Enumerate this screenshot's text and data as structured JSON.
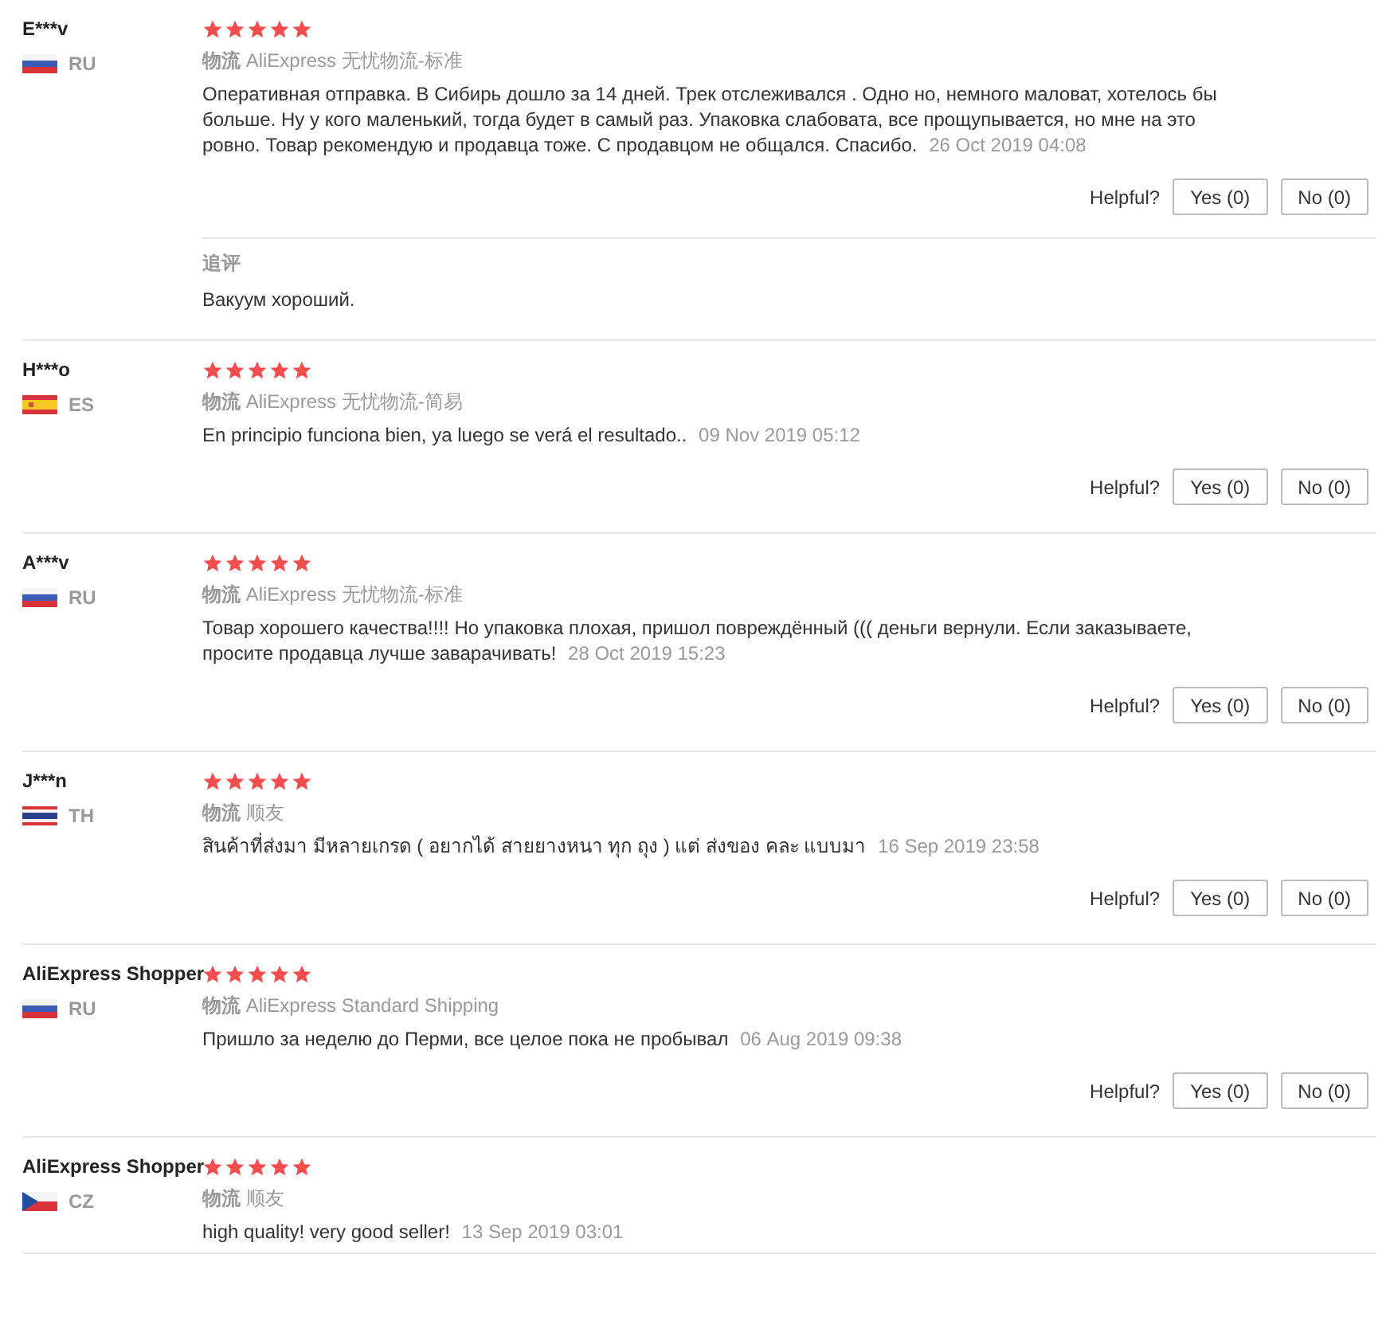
{
  "reviews": [
    {
      "name": "E***v",
      "flag": {
        "kind": "ru"
      },
      "country": "RU",
      "stars": 5,
      "shipping_label": "物流",
      "shipping": "AliExpress 无忧物流-标准",
      "text": "Оперативная отправка. В Сибирь дошло за 14 дней. Трек отслеживался . Одно но, немного маловат, хотелось бы больше. Ну у кого маленький, тогда будет в самый раз. Упаковка слабовата, все прощупывается, но мне на это ровно. Товар рекомендую и продавца тоже. С продавцом не общался. Спасибо.",
      "date": "26 Oct 2019 04:08",
      "helpful": {
        "label": "Helpful?",
        "yes": "Yes (0)",
        "no": "No (0)"
      },
      "followup": {
        "label": "追评",
        "text": "Вакуум хороший."
      }
    },
    {
      "name": "H***o",
      "flag": {
        "kind": "es"
      },
      "country": "ES",
      "stars": 5,
      "shipping_label": "物流",
      "shipping": "AliExpress 无忧物流-简易",
      "text": "En principio funciona bien, ya luego se verá el resultado..",
      "date": "09 Nov 2019 05:12",
      "helpful": {
        "label": "Helpful?",
        "yes": "Yes (0)",
        "no": "No (0)"
      }
    },
    {
      "name": "A***v",
      "flag": {
        "kind": "ru"
      },
      "country": "RU",
      "stars": 5,
      "shipping_label": "物流",
      "shipping": "AliExpress 无忧物流-标准",
      "text": "Товар хорошего качества!!!! Но упаковка плохая, пришол повреждённый ((( деньги вернули. Если заказываете, просите продавца лучше заварачивать!",
      "date": "28 Oct 2019 15:23",
      "helpful": {
        "label": "Helpful?",
        "yes": "Yes (0)",
        "no": "No (0)"
      }
    },
    {
      "name": "J***n",
      "flag": {
        "kind": "th"
      },
      "country": "TH",
      "stars": 5,
      "shipping_label": "物流",
      "shipping": "顺友",
      "text": "สินค้าที่ส่งมา มีหลายเกรด ( อยากได้ สายยางหนา ทุก ถุง ) แต่ ส่งของ คละ แบบมา",
      "date": "16 Sep 2019 23:58",
      "helpful": {
        "label": "Helpful?",
        "yes": "Yes (0)",
        "no": "No (0)"
      }
    },
    {
      "name": "AliExpress Shopper",
      "flag": {
        "kind": "ru"
      },
      "country": "RU",
      "stars": 5,
      "shipping_label": "物流",
      "shipping": "AliExpress Standard Shipping",
      "text": "Пришло за неделю до Перми, все целое пока не пробывал",
      "date": "06 Aug 2019 09:38",
      "helpful": {
        "label": "Helpful?",
        "yes": "Yes (0)",
        "no": "No (0)"
      }
    },
    {
      "name": "AliExpress Shopper",
      "flag": {
        "kind": "cz"
      },
      "country": "CZ",
      "stars": 5,
      "shipping_label": "物流",
      "shipping": "顺友",
      "text": "high quality! very good seller!",
      "date": "13 Sep 2019 03:01"
    }
  ]
}
